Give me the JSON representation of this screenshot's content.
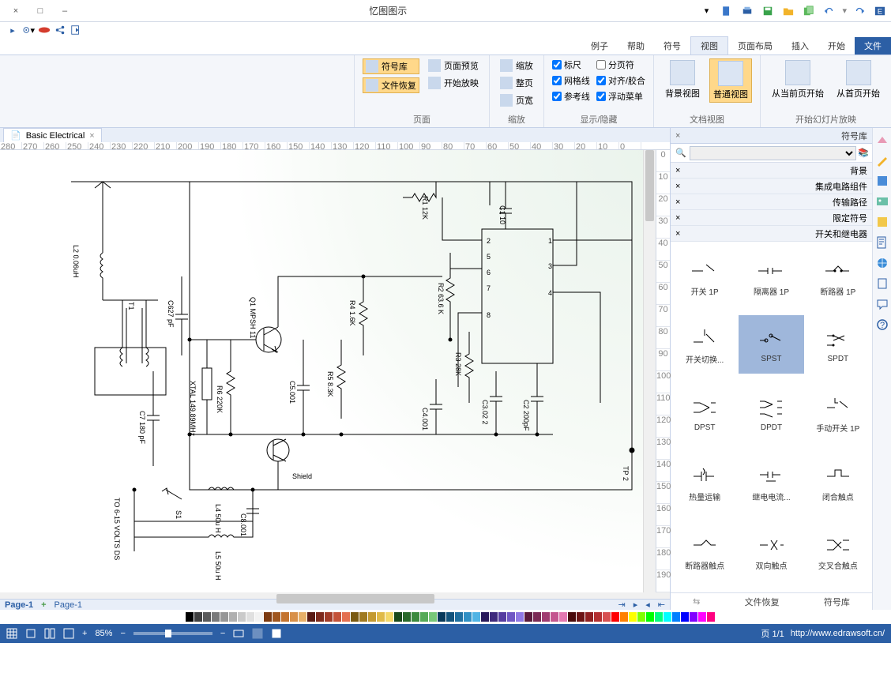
{
  "title": "忆图图示",
  "window_controls": {
    "close": "×",
    "max": "□",
    "min": "–"
  },
  "menu_tabs": [
    "文件",
    "开始",
    "插入",
    "页面布局",
    "视图",
    "符号",
    "帮助",
    "例子"
  ],
  "menu_active_file_index": 0,
  "menu_active_index": 4,
  "ribbon": {
    "groups": [
      {
        "title": "开始幻灯片放映",
        "big": [
          {
            "label": "从首页开始"
          },
          {
            "label": "从当前页开始"
          }
        ]
      },
      {
        "title": "文档视图",
        "big": [
          {
            "label": "普通视图"
          },
          {
            "label": "背景视图"
          }
        ]
      },
      {
        "title": "显示/隐藏",
        "checks": [
          {
            "label": "标尺",
            "v": true
          },
          {
            "label": "分页符",
            "v": false
          },
          {
            "label": "网格线",
            "v": true
          },
          {
            "label": "对齐/胶合",
            "v": true
          },
          {
            "label": "参考线",
            "v": true
          },
          {
            "label": "浮动菜单",
            "v": true
          }
        ]
      },
      {
        "title": "缩放",
        "items": [
          {
            "label": "缩放"
          },
          {
            "label": "整页"
          },
          {
            "label": "页宽"
          }
        ]
      },
      {
        "title": "页面",
        "items": [
          {
            "label": "符号库",
            "sub": "文件恢复",
            "selected": true
          },
          {
            "label": "页面预览"
          },
          {
            "label": "开始放映"
          }
        ]
      }
    ]
  },
  "symbol_panel": {
    "title": "符号库",
    "accordions": [
      "背景",
      "集成电路组件",
      "传输路径",
      "限定符号",
      "开关和继电器"
    ],
    "symbols": [
      "开关 1P",
      "隔离器 1P",
      "断路器 1P",
      "开关切换...",
      "SPST",
      "SPDT",
      "DPST",
      "DPDT",
      "手动开关 1P",
      "热量运输",
      "继电电流...",
      "闭合触点",
      "断路器触点",
      "双向触点",
      "交叉合触点"
    ],
    "selected_index": 4,
    "footer": [
      "符号库",
      "文件恢复"
    ]
  },
  "doc_tab": "Basic Electrical",
  "ruler_h": [
    "0",
    "10",
    "20",
    "30",
    "40",
    "50",
    "60",
    "70",
    "80",
    "90",
    "100",
    "110",
    "120",
    "130",
    "140",
    "150",
    "160",
    "170",
    "180",
    "190",
    "200",
    "210",
    "220",
    "230",
    "240",
    "250",
    "260",
    "270",
    "280"
  ],
  "ruler_v": [
    "0",
    "10",
    "20",
    "30",
    "40",
    "50",
    "60",
    "70",
    "80",
    "90",
    "100",
    "110",
    "120",
    "130",
    "140",
    "150",
    "160",
    "170",
    "180",
    "190"
  ],
  "page_tabs": {
    "current": "Page-1",
    "extra": "Page-1",
    "add": "+"
  },
  "colors": [
    "#ffffff",
    "#000000",
    "#404040",
    "#5a5a5a",
    "#7a7a7a",
    "#969696",
    "#b0b0b0",
    "#cacaca",
    "#e0e0e0",
    "#f2f2f2",
    "#7c3a10",
    "#a0561e",
    "#c4742f",
    "#d89048",
    "#e8b068",
    "#5a1a12",
    "#7e2a1c",
    "#a23c28",
    "#c45238",
    "#e47050",
    "#7a5a10",
    "#a07a20",
    "#c49a30",
    "#e0ba48",
    "#f4d868",
    "#1a4a1a",
    "#2a6a2a",
    "#3c8a3c",
    "#56aa56",
    "#78c878",
    "#0a3a5a",
    "#14547c",
    "#2070a0",
    "#3090c4",
    "#50b4e4",
    "#2a1a5a",
    "#402a7c",
    "#563ca0",
    "#7056c4",
    "#9078e4",
    "#5a1a3a",
    "#7c2a54",
    "#a03c70",
    "#c4568e",
    "#e478b0",
    "#4a0a0a",
    "#6c1414",
    "#902020",
    "#b43030",
    "#d85050",
    "#ff0000",
    "#ff8000",
    "#ffff00",
    "#80ff00",
    "#00ff00",
    "#00ff80",
    "#00ffff",
    "#0080ff",
    "#0000ff",
    "#8000ff",
    "#ff00ff",
    "#ff0080"
  ],
  "status": {
    "url": "http://www.edrawsoft.cn/",
    "page": "页 1/1",
    "zoom": "85%"
  },
  "circuit": {
    "labels": {
      "l2": "L2 0.06uH",
      "t1": "T1",
      "c627": "C627 pF",
      "q1": "Q1 MPSH 11",
      "r4": "R4 1.6K",
      "r5": "R5 8.3K",
      "xtal": "XTAL 149.89MHz",
      "r6": "R6 220K",
      "shield": "Shield",
      "c7": "C7 180 pF",
      "c8": "C8.001",
      "s1": "S1",
      "l4": "L4 50u H",
      "l5": "L5 50u H",
      "c5": "C5.001",
      "c4": "C4.001",
      "c3": "C3.02 2",
      "c2": "C2 200pF",
      "r1": "R1 12K",
      "r2": "R2 63.6 K",
      "r3": "R3 28K",
      "c1": "C1 10",
      "tp2": "TP 2",
      "volts": "TO 6-15 VOLTS DS"
    }
  }
}
